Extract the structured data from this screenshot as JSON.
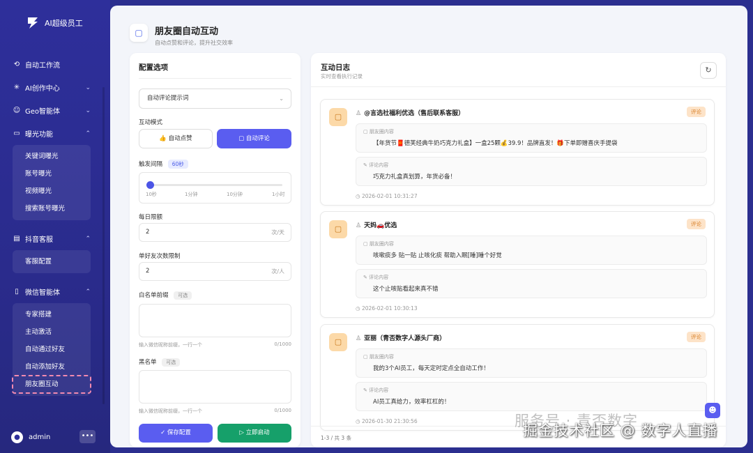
{
  "app": {
    "name": "AI超级员工"
  },
  "sidebar": {
    "items": [
      {
        "label": "自动工作流",
        "icon": "flow-icon"
      },
      {
        "label": "AI创作中心",
        "icon": "sparkle-icon"
      },
      {
        "label": "Geo智能体",
        "icon": "user-icon"
      },
      {
        "label": "曝光功能",
        "icon": "monitor-icon"
      },
      {
        "label": "抖音客服",
        "icon": "chat-icon"
      },
      {
        "label": "微信智能体",
        "icon": "phone-icon"
      }
    ],
    "exposure_sub": [
      "关键词曝光",
      "账号曝光",
      "视频曝光",
      "搜索账号曝光"
    ],
    "douyin_sub": [
      "客服配置"
    ],
    "wechat_sub": [
      "专家搭建",
      "主动激活",
      "自动通过好友",
      "自动添加好友",
      "朋友圈互动"
    ],
    "user": "admin"
  },
  "page": {
    "title": "朋友圈自动互动",
    "subtitle": "自动点赞和评论，提升社交效率"
  },
  "config": {
    "title": "配置选项",
    "prompt_select": "自动评论提示词",
    "mode_label": "互动模式",
    "like_button": "自动点赞",
    "comment_button": "自动评论",
    "interval_label": "触发间隔",
    "interval_value": "60秒",
    "interval_level": 0.0,
    "ticks": [
      "10秒",
      "1分钟",
      "10分钟",
      "1小时"
    ],
    "daily_label": "每日限额",
    "daily_value": "2",
    "daily_unit": "次/天",
    "friend_label": "单好友次数限制",
    "friend_value": "2",
    "friend_unit": "次/人",
    "whitelist_label": "白名单前缀",
    "optional": "可选",
    "whitelist_hint": "输入微信昵称前缀，一行一个",
    "whitelist_count": "0/1000",
    "blacklist_label": "黑名单",
    "blacklist_hint": "输入微信昵称前缀，一行一个",
    "blacklist_count": "0/1000",
    "save_button": "保存配置",
    "start_button": "立即启动"
  },
  "log": {
    "title": "互动日志",
    "subtitle": "实时查看执行记录",
    "moment_label": "朋友圈内容",
    "comment_label": "评论内容",
    "entries": [
      {
        "name": "@言选社福利优选（售后联系客服）",
        "tag": "评论",
        "moment": "【年货节🧧德芙经典牛奶巧克力礼盒】一盒25颗💰39.9！品牌直发！🎁下单即赠喜庆手提袋",
        "comment": "巧克力礼盒真划算，年货必备！",
        "time": "2026-02-01 10:31:27"
      },
      {
        "name": "天妈🚗优选",
        "tag": "评论",
        "moment": "咳嗽痰多 贴一贴 止咳化痰 帮助入眠[睡]睡个好觉",
        "comment": "这个止咳贴看起来真不错",
        "time": "2026-02-01 10:30:13"
      },
      {
        "name": "亚丽（青否数字人源头厂商）",
        "tag": "评论",
        "moment": "我的3个AI员工，每天定时定点全自动工作！",
        "comment": "AI员工真给力，效率杠杠的！",
        "time": "2026-01-30 21:30:56"
      }
    ],
    "pager": "1-3 / 共 3 条"
  },
  "watermark": {
    "line1": "服务号 · 青否数字",
    "line2": "掘金技术社区 @ 数字人直播"
  },
  "colors": {
    "primary": "#5a5df0",
    "success": "#16a06a",
    "sidebar": "#2e2f9b",
    "tag": "#d9822b"
  }
}
